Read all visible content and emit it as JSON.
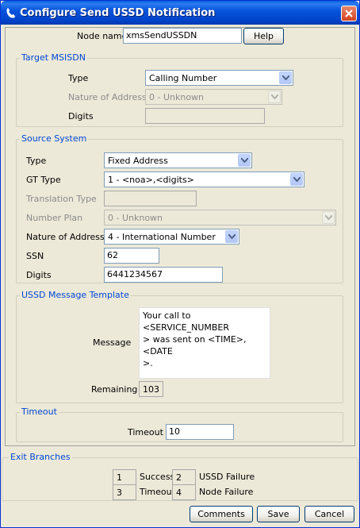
{
  "window": {
    "title": "Configure Send USSD Notification"
  },
  "node": {
    "label": "Node name",
    "value": "xmsSendUSSDN",
    "help_label": "Help"
  },
  "target": {
    "legend": "Target MSISDN",
    "type_label": "Type",
    "type_value": "Calling Number",
    "noa_label": "Nature of Address",
    "noa_value": "0 - Unknown",
    "digits_label": "Digits",
    "digits_value": ""
  },
  "source": {
    "legend": "Source System",
    "type_label": "Type",
    "type_value": "Fixed Address",
    "gt_label": "GT Type",
    "gt_value": "1 - <noa>,<digits>",
    "tt_label": "Translation Type",
    "tt_value": "",
    "np_label": "Number Plan",
    "np_value": "0 - Unknown",
    "noa_label": "Nature of Address",
    "noa_value": "4 - International Number",
    "ssn_label": "SSN",
    "ssn_value": "62",
    "digits_label": "Digits",
    "digits_value": "6441234567"
  },
  "ussd": {
    "legend": "USSD Message Template",
    "message_label": "Message",
    "message_value": "Your call to <SERVICE_NUMBER\n> was sent on <TIME>, <DATE\n>.",
    "remaining_label": "Remaining",
    "remaining_value": "103"
  },
  "timeout": {
    "legend": "Timeout",
    "label": "Timeout",
    "value": "10"
  },
  "exits": {
    "legend": "Exit Branches",
    "items": [
      {
        "num": "1",
        "label": "Success"
      },
      {
        "num": "2",
        "label": "USSD Failure"
      },
      {
        "num": "3",
        "label": "Timeout"
      },
      {
        "num": "4",
        "label": "Node Failure"
      }
    ]
  },
  "footer": {
    "comments_label": "Comments",
    "save_label": "Save",
    "cancel_label": "Cancel"
  },
  "colors": {
    "title_bar": "#0855dd",
    "legend_text": "#0046d5",
    "window_bg": "#ece9d8"
  }
}
